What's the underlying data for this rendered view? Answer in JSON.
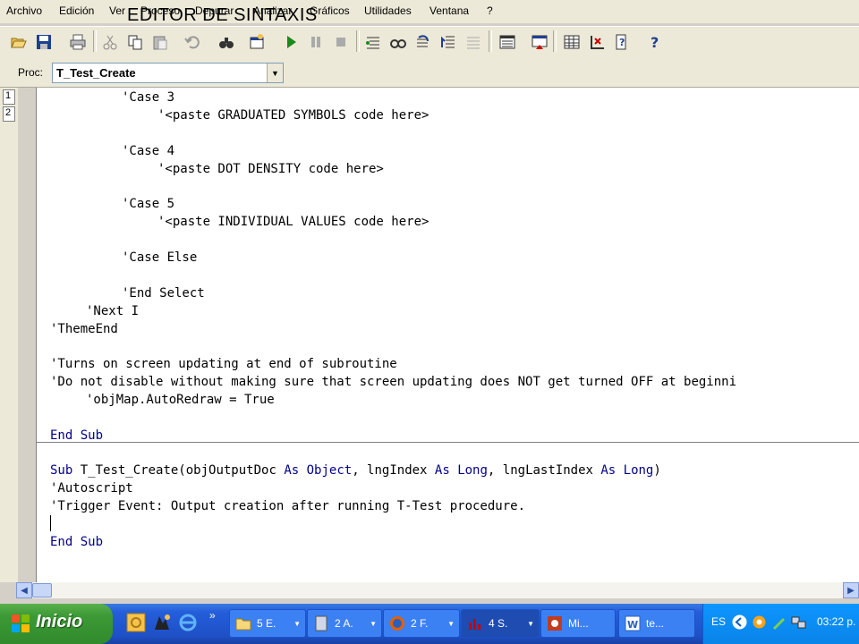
{
  "overlay_title": "EDITOR DE SINTAXIS",
  "menu": [
    "Archivo",
    "Edición",
    "Ver",
    "Proceso",
    "Depurar",
    "Analizar",
    "Gráficos",
    "Utilidades",
    "Ventana",
    "?"
  ],
  "proc": {
    "label": "Proc:",
    "value": "T_Test_Create"
  },
  "line_numbers": [
    "1",
    "2"
  ],
  "code": {
    "l1": "'Case 3",
    "l2": "'<paste GRADUATED SYMBOLS code here>",
    "l3": "'Case 4",
    "l4": "'<paste DOT DENSITY code here>",
    "l5": "'Case 5",
    "l6": "'<paste INDIVIDUAL VALUES code here>",
    "l7": "'Case Else",
    "l8": "'End Select",
    "l9": "'Next I",
    "l10": "'ThemeEnd",
    "l11": "'Turns on screen updating at end of subroutine",
    "l12": "'Do not disable without making sure that screen updating does NOT get turned OFF at beginni",
    "l13": "'objMap.AutoRedraw = True",
    "end_sub_1": "End Sub",
    "sub_kw": "Sub",
    "sub_name": " T_Test_Create(objOutputDoc ",
    "as1": "As",
    "type1": " Object",
    "mid1": ", lngIndex ",
    "as2": "As",
    "type2": " Long",
    "mid2": ", lngLastIndex ",
    "as3": "As",
    "type3": " Long",
    "close": ")",
    "autoscript": "'Autoscript",
    "trigger": "'Trigger Event: Output creation after running T-Test procedure.",
    "end_sub_2": "End Sub"
  },
  "taskbar": {
    "start": "Inicio",
    "tasks": [
      "5 E.",
      "2 A.",
      "2 F.",
      "4 S.",
      "Mi...",
      "te..."
    ],
    "lang": "ES",
    "clock": "03:22 p."
  },
  "colors": {
    "keyword": "#00008b",
    "taskbar": "#245edb",
    "start": "#3c9a36"
  }
}
